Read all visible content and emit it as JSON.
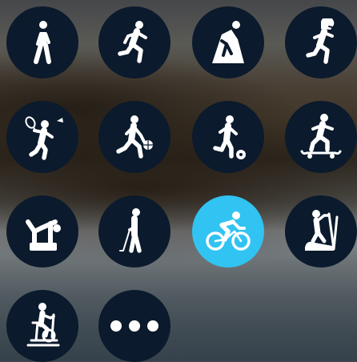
{
  "colors": {
    "tile_background": "#0b1a2c",
    "selected_tile_background": "#31c3f2",
    "icon_color": "#ffffff"
  },
  "activities": [
    {
      "icon": "walking-icon"
    },
    {
      "icon": "running-icon"
    },
    {
      "icon": "climbing-icon"
    },
    {
      "icon": "football-icon"
    },
    {
      "icon": "badminton-icon"
    },
    {
      "icon": "basketball-icon"
    },
    {
      "icon": "soccer-icon"
    },
    {
      "icon": "skateboarding-icon"
    },
    {
      "icon": "aerobics-icon"
    },
    {
      "icon": "golf-icon"
    },
    {
      "icon": "cycling-icon",
      "selected": true
    },
    {
      "icon": "elliptical-icon"
    },
    {
      "icon": "stationary-bike-icon"
    },
    {
      "icon": "more-icon"
    }
  ]
}
